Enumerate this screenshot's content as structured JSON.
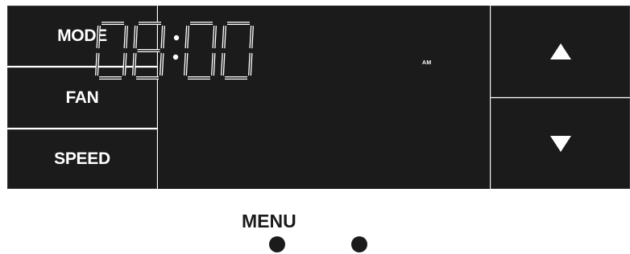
{
  "buttons": {
    "mode_label": "MODE",
    "fan_label": "FAN",
    "speed_label": "SPEED"
  },
  "display": {
    "time": "08:00",
    "period": "AM",
    "color": "#ffffff",
    "background": "#1b1b1b"
  },
  "arrows": {
    "up_icon": "triangle-up-icon",
    "down_icon": "triangle-down-icon"
  },
  "menu": {
    "label": "MENU"
  }
}
